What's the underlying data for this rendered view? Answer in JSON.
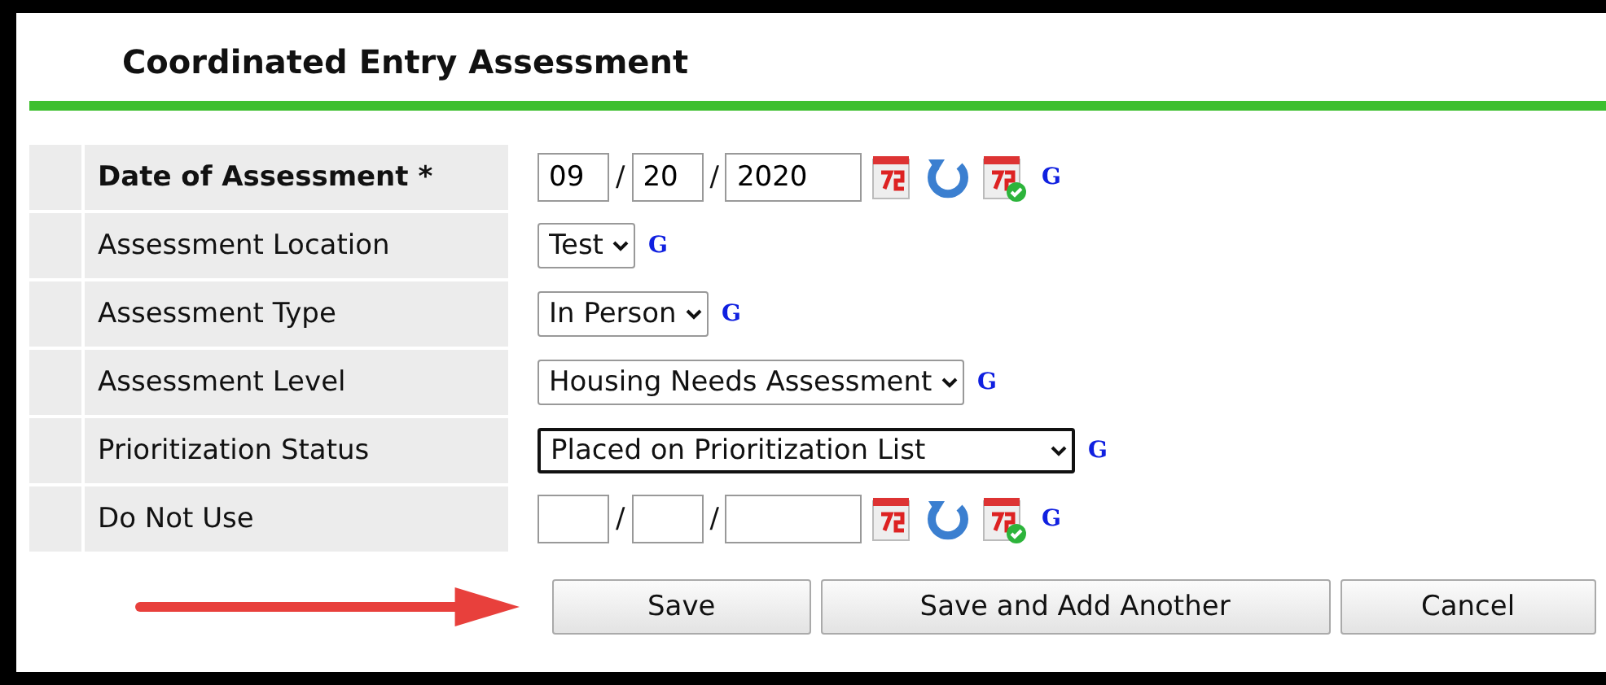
{
  "title": "Coordinated Entry Assessment",
  "rows": [
    {
      "kind": "date",
      "label": "Date of Assessment",
      "required": "*",
      "month": "09",
      "day": "20",
      "year": "2020",
      "separators": [
        "/",
        "/"
      ],
      "link": "G"
    },
    {
      "kind": "select",
      "label": "Assessment Location",
      "value": "Test",
      "focused": false,
      "link": "G"
    },
    {
      "kind": "select",
      "label": "Assessment Type",
      "value": "In Person",
      "focused": false,
      "link": "G"
    },
    {
      "kind": "select",
      "label": "Assessment Level",
      "value": "Housing Needs Assessment",
      "focused": false,
      "link": "G"
    },
    {
      "kind": "select",
      "label": "Prioritization Status",
      "value": "Placed on Prioritization List",
      "focused": true,
      "link": "G"
    },
    {
      "kind": "date",
      "label": "Do Not Use",
      "month": "",
      "day": "",
      "year": "",
      "separators": [
        "/",
        "/"
      ],
      "link": "G"
    }
  ],
  "buttons": [
    "Save",
    "Save and Add Another",
    "Cancel"
  ]
}
